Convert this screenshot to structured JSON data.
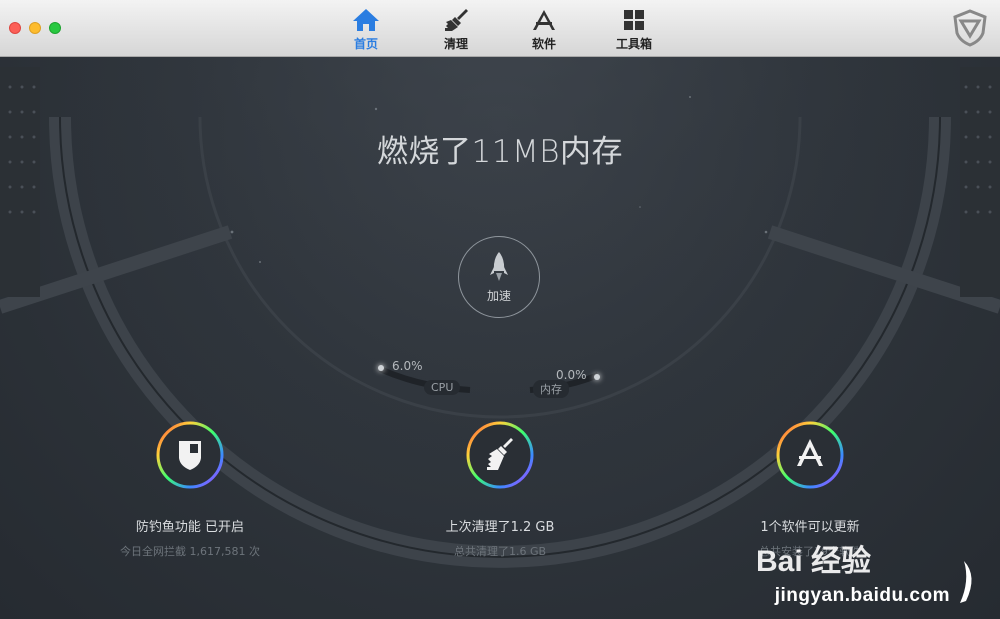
{
  "titlebar": {
    "tabs": [
      {
        "label": "首页",
        "icon": "home-icon",
        "active": true
      },
      {
        "label": "清理",
        "icon": "broom-icon",
        "active": false
      },
      {
        "label": "软件",
        "icon": "app-store-icon",
        "active": false
      },
      {
        "label": "工具箱",
        "icon": "grid-icon",
        "active": false
      }
    ],
    "logo_icon": "shield-logo-icon"
  },
  "main": {
    "headline": "燃烧了11MB内存",
    "boost_label": "加速",
    "cpu": {
      "value": "6.0%",
      "label": "CPU"
    },
    "memory": {
      "value": "0.0%",
      "label": "内存"
    }
  },
  "features": [
    {
      "title": "防钓鱼功能  已开启",
      "sub": "今日全网拦截 1,617,581 次",
      "icon": "shield-icon"
    },
    {
      "title": "上次清理了1.2 GB",
      "sub": "总共清理了1.6 GB",
      "icon": "broom-icon"
    },
    {
      "title": "1个软件可以更新",
      "sub": "总共安装了19个软件",
      "icon": "app-store-icon"
    }
  ],
  "watermark": {
    "brand": "Bai 经验",
    "url": "jingyan.baidu.com"
  },
  "colors": {
    "accent": "#2a7de1",
    "background": "#2f353c"
  }
}
